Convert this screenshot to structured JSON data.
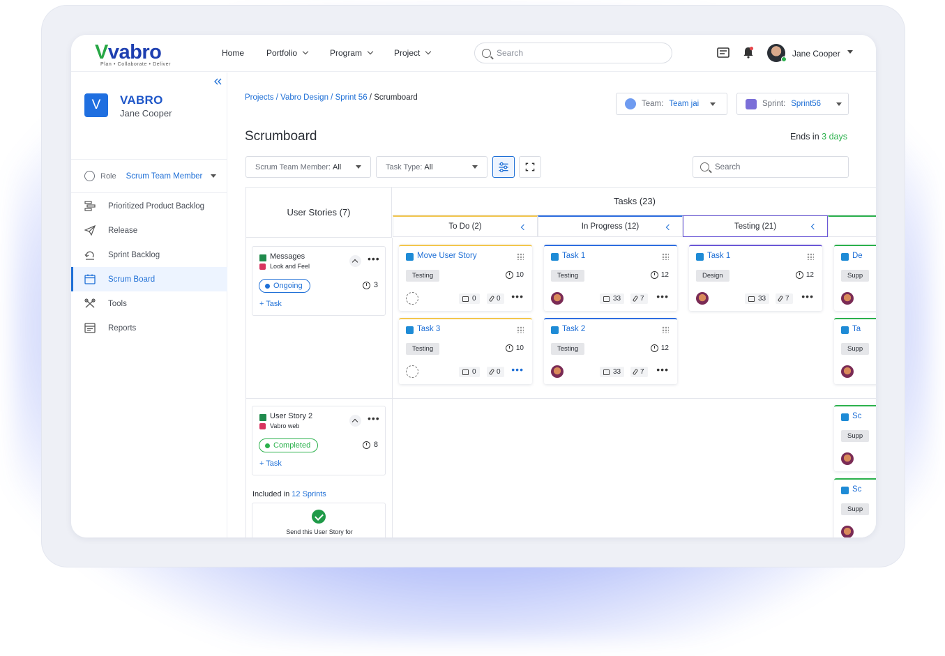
{
  "brand": {
    "name_part1": "V",
    "name_part2": "vabro",
    "tagline": "Plan • Collaborate • Deliver"
  },
  "nav": [
    {
      "label": "Home",
      "has_menu": false
    },
    {
      "label": "Portfolio",
      "has_menu": true
    },
    {
      "label": "Program",
      "has_menu": true
    },
    {
      "label": "Project",
      "has_menu": true
    }
  ],
  "top_search": {
    "placeholder": "Search"
  },
  "user": {
    "name": "Jane Cooper",
    "status_color": "#2bb14c"
  },
  "sidebar": {
    "workspace_initial": "V",
    "workspace_name": "VABRO",
    "workspace_user": "Jane Cooper",
    "role_label": "Role",
    "role_value": "Scrum Team Member",
    "items": [
      {
        "label": "Prioritized Product Backlog",
        "icon": "backlog-icon",
        "active": false
      },
      {
        "label": "Release",
        "icon": "send-icon",
        "active": false
      },
      {
        "label": "Sprint Backlog",
        "icon": "refresh-icon",
        "active": false
      },
      {
        "label": "Scrum Board",
        "icon": "calendar-icon",
        "active": true
      },
      {
        "label": "Tools",
        "icon": "tools-icon",
        "active": false
      },
      {
        "label": "Reports",
        "icon": "reports-icon",
        "active": false
      }
    ]
  },
  "breadcrumb": {
    "items": [
      "Projects",
      "Vabro Design",
      "Sprint 56"
    ],
    "current": "Scrumboard",
    "sep": " / "
  },
  "team_select": {
    "label": "Team:",
    "value": "Team jai"
  },
  "sprint_select": {
    "label": "Sprint:",
    "value": "Sprint56"
  },
  "page_title": "Scrumboard",
  "ends": {
    "prefix": "Ends in",
    "value": "3 days"
  },
  "filters": {
    "member_label": "Scrum Team Member:",
    "member_value": "All",
    "type_label": "Task Type:",
    "type_value": "All",
    "search_placeholder": "Search"
  },
  "board": {
    "user_stories_header": "User Stories (7)",
    "tasks_header": "Tasks (23)",
    "columns": [
      {
        "label": "To Do (2)",
        "accent": "#f3c64c"
      },
      {
        "label": "In Progress (12)",
        "accent": "#2d6de0"
      },
      {
        "label": "Testing (21)",
        "accent": "#6b58d6"
      }
    ],
    "stories": [
      {
        "title": "Messages",
        "sub": "Look and Feel",
        "status": "Ongoing",
        "estimate": "3",
        "add_task": "Task"
      },
      {
        "title": "User Story 2",
        "sub": "Vabro web",
        "status": "Completed",
        "estimate": "8",
        "add_task": "Task"
      }
    ],
    "todo_cards": [
      {
        "title": "Move User Story",
        "tag": "Testing",
        "estimate": "10",
        "comments": "0",
        "attachments": "0"
      },
      {
        "title": "Task 3",
        "tag": "Testing",
        "estimate": "10",
        "comments": "0",
        "attachments": "0"
      }
    ],
    "progress_cards": [
      {
        "title": "Task 1",
        "tag": "Testing",
        "estimate": "12",
        "comments": "33",
        "attachments": "7"
      },
      {
        "title": "Task 2",
        "tag": "Testing",
        "estimate": "12",
        "comments": "33",
        "attachments": "7"
      }
    ],
    "testing_cards": [
      {
        "title": "Task 1",
        "tag": "Design",
        "estimate": "12",
        "comments": "33",
        "attachments": "7"
      }
    ],
    "next_cards": [
      {
        "title": "De",
        "tag": "Supp"
      },
      {
        "title": "Ta",
        "tag": "Supp"
      },
      {
        "title": "Sc",
        "tag": "Supp"
      },
      {
        "title": "Sc",
        "tag": "Supp"
      }
    ],
    "included": {
      "prefix": "Included in",
      "link": "12 Sprints"
    },
    "send_text": "Send this User Story for"
  }
}
